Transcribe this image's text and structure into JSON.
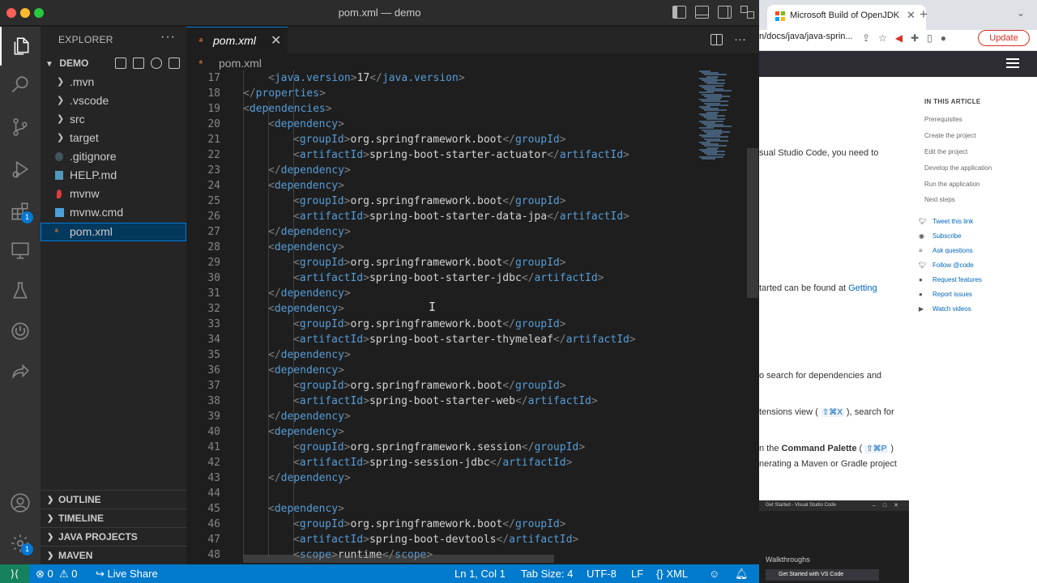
{
  "window": {
    "title": "pom.xml — demo"
  },
  "activity_badges": {
    "extensions": "1",
    "accounts": "1"
  },
  "sidebar": {
    "title": "EXPLORER",
    "more": "···",
    "project": "DEMO",
    "items": [
      {
        "label": ".mvn",
        "type": "folder"
      },
      {
        "label": ".vscode",
        "type": "folder"
      },
      {
        "label": "src",
        "type": "folder"
      },
      {
        "label": "target",
        "type": "folder"
      },
      {
        "label": ".gitignore",
        "type": "file"
      },
      {
        "label": "HELP.md",
        "type": "file"
      },
      {
        "label": "mvnw",
        "type": "file"
      },
      {
        "label": "mvnw.cmd",
        "type": "file"
      },
      {
        "label": "pom.xml",
        "type": "file",
        "selected": true
      }
    ],
    "sections": [
      "OUTLINE",
      "TIMELINE",
      "JAVA PROJECTS",
      "MAVEN"
    ]
  },
  "editor": {
    "tab_label": "pom.xml",
    "tab_close": "✕",
    "breadcrumb": "pom.xml",
    "lines": [
      {
        "n": "17",
        "indent": 2,
        "parts": [
          [
            "br",
            "<"
          ],
          [
            "tg",
            "java.version"
          ],
          [
            "br",
            ">"
          ],
          [
            "tx",
            "17"
          ],
          [
            "br",
            "</"
          ],
          [
            "tg",
            "java.version"
          ],
          [
            "br",
            ">"
          ]
        ]
      },
      {
        "n": "18",
        "indent": 1,
        "parts": [
          [
            "br",
            "</"
          ],
          [
            "tg",
            "properties"
          ],
          [
            "br",
            ">"
          ]
        ]
      },
      {
        "n": "19",
        "indent": 1,
        "parts": [
          [
            "br",
            "<"
          ],
          [
            "tg",
            "dependencies"
          ],
          [
            "br",
            ">"
          ]
        ]
      },
      {
        "n": "20",
        "indent": 2,
        "parts": [
          [
            "br",
            "<"
          ],
          [
            "tg",
            "dependency"
          ],
          [
            "br",
            ">"
          ]
        ]
      },
      {
        "n": "21",
        "indent": 3,
        "parts": [
          [
            "br",
            "<"
          ],
          [
            "tg",
            "groupId"
          ],
          [
            "br",
            ">"
          ],
          [
            "tx",
            "org.springframework.boot"
          ],
          [
            "br",
            "</"
          ],
          [
            "tg",
            "groupId"
          ],
          [
            "br",
            ">"
          ]
        ]
      },
      {
        "n": "22",
        "indent": 3,
        "parts": [
          [
            "br",
            "<"
          ],
          [
            "tg",
            "artifactId"
          ],
          [
            "br",
            ">"
          ],
          [
            "tx",
            "spring-boot-starter-actuator"
          ],
          [
            "br",
            "</"
          ],
          [
            "tg",
            "artifactId"
          ],
          [
            "br",
            ">"
          ]
        ]
      },
      {
        "n": "23",
        "indent": 2,
        "parts": [
          [
            "br",
            "</"
          ],
          [
            "tg",
            "dependency"
          ],
          [
            "br",
            ">"
          ]
        ]
      },
      {
        "n": "24",
        "indent": 2,
        "parts": [
          [
            "br",
            "<"
          ],
          [
            "tg",
            "dependency"
          ],
          [
            "br",
            ">"
          ]
        ]
      },
      {
        "n": "25",
        "indent": 3,
        "parts": [
          [
            "br",
            "<"
          ],
          [
            "tg",
            "groupId"
          ],
          [
            "br",
            ">"
          ],
          [
            "tx",
            "org.springframework.boot"
          ],
          [
            "br",
            "</"
          ],
          [
            "tg",
            "groupId"
          ],
          [
            "br",
            ">"
          ]
        ]
      },
      {
        "n": "26",
        "indent": 3,
        "parts": [
          [
            "br",
            "<"
          ],
          [
            "tg",
            "artifactId"
          ],
          [
            "br",
            ">"
          ],
          [
            "tx",
            "spring-boot-starter-data-jpa"
          ],
          [
            "br",
            "</"
          ],
          [
            "tg",
            "artifactId"
          ],
          [
            "br",
            ">"
          ]
        ]
      },
      {
        "n": "27",
        "indent": 2,
        "parts": [
          [
            "br",
            "</"
          ],
          [
            "tg",
            "dependency"
          ],
          [
            "br",
            ">"
          ]
        ]
      },
      {
        "n": "28",
        "indent": 2,
        "parts": [
          [
            "br",
            "<"
          ],
          [
            "tg",
            "dependency"
          ],
          [
            "br",
            ">"
          ]
        ]
      },
      {
        "n": "29",
        "indent": 3,
        "parts": [
          [
            "br",
            "<"
          ],
          [
            "tg",
            "groupId"
          ],
          [
            "br",
            ">"
          ],
          [
            "tx",
            "org.springframework.boot"
          ],
          [
            "br",
            "</"
          ],
          [
            "tg",
            "groupId"
          ],
          [
            "br",
            ">"
          ]
        ]
      },
      {
        "n": "30",
        "indent": 3,
        "parts": [
          [
            "br",
            "<"
          ],
          [
            "tg",
            "artifactId"
          ],
          [
            "br",
            ">"
          ],
          [
            "tx",
            "spring-boot-starter-jdbc"
          ],
          [
            "br",
            "</"
          ],
          [
            "tg",
            "artifactId"
          ],
          [
            "br",
            ">"
          ]
        ]
      },
      {
        "n": "31",
        "indent": 2,
        "parts": [
          [
            "br",
            "</"
          ],
          [
            "tg",
            "dependency"
          ],
          [
            "br",
            ">"
          ]
        ]
      },
      {
        "n": "32",
        "indent": 2,
        "parts": [
          [
            "br",
            "<"
          ],
          [
            "tg",
            "dependency"
          ],
          [
            "br",
            ">"
          ]
        ]
      },
      {
        "n": "33",
        "indent": 3,
        "parts": [
          [
            "br",
            "<"
          ],
          [
            "tg",
            "groupId"
          ],
          [
            "br",
            ">"
          ],
          [
            "tx",
            "org.springframework.boot"
          ],
          [
            "br",
            "</"
          ],
          [
            "tg",
            "groupId"
          ],
          [
            "br",
            ">"
          ]
        ]
      },
      {
        "n": "34",
        "indent": 3,
        "parts": [
          [
            "br",
            "<"
          ],
          [
            "tg",
            "artifactId"
          ],
          [
            "br",
            ">"
          ],
          [
            "tx",
            "spring-boot-starter-thymeleaf"
          ],
          [
            "br",
            "</"
          ],
          [
            "tg",
            "artifactId"
          ],
          [
            "br",
            ">"
          ]
        ]
      },
      {
        "n": "35",
        "indent": 2,
        "parts": [
          [
            "br",
            "</"
          ],
          [
            "tg",
            "dependency"
          ],
          [
            "br",
            ">"
          ]
        ]
      },
      {
        "n": "36",
        "indent": 2,
        "parts": [
          [
            "br",
            "<"
          ],
          [
            "tg",
            "dependency"
          ],
          [
            "br",
            ">"
          ]
        ]
      },
      {
        "n": "37",
        "indent": 3,
        "parts": [
          [
            "br",
            "<"
          ],
          [
            "tg",
            "groupId"
          ],
          [
            "br",
            ">"
          ],
          [
            "tx",
            "org.springframework.boot"
          ],
          [
            "br",
            "</"
          ],
          [
            "tg",
            "groupId"
          ],
          [
            "br",
            ">"
          ]
        ]
      },
      {
        "n": "38",
        "indent": 3,
        "parts": [
          [
            "br",
            "<"
          ],
          [
            "tg",
            "artifactId"
          ],
          [
            "br",
            ">"
          ],
          [
            "tx",
            "spring-boot-starter-web"
          ],
          [
            "br",
            "</"
          ],
          [
            "tg",
            "artifactId"
          ],
          [
            "br",
            ">"
          ]
        ]
      },
      {
        "n": "39",
        "indent": 2,
        "parts": [
          [
            "br",
            "</"
          ],
          [
            "tg",
            "dependency"
          ],
          [
            "br",
            ">"
          ]
        ]
      },
      {
        "n": "40",
        "indent": 2,
        "parts": [
          [
            "br",
            "<"
          ],
          [
            "tg",
            "dependency"
          ],
          [
            "br",
            ">"
          ]
        ]
      },
      {
        "n": "41",
        "indent": 3,
        "parts": [
          [
            "br",
            "<"
          ],
          [
            "tg",
            "groupId"
          ],
          [
            "br",
            ">"
          ],
          [
            "tx",
            "org.springframework.session"
          ],
          [
            "br",
            "</"
          ],
          [
            "tg",
            "groupId"
          ],
          [
            "br",
            ">"
          ]
        ]
      },
      {
        "n": "42",
        "indent": 3,
        "parts": [
          [
            "br",
            "<"
          ],
          [
            "tg",
            "artifactId"
          ],
          [
            "br",
            ">"
          ],
          [
            "tx",
            "spring-session-jdbc"
          ],
          [
            "br",
            "</"
          ],
          [
            "tg",
            "artifactId"
          ],
          [
            "br",
            ">"
          ]
        ]
      },
      {
        "n": "43",
        "indent": 2,
        "parts": [
          [
            "br",
            "</"
          ],
          [
            "tg",
            "dependency"
          ],
          [
            "br",
            ">"
          ]
        ]
      },
      {
        "n": "44",
        "indent": 0,
        "parts": []
      },
      {
        "n": "45",
        "indent": 2,
        "parts": [
          [
            "br",
            "<"
          ],
          [
            "tg",
            "dependency"
          ],
          [
            "br",
            ">"
          ]
        ]
      },
      {
        "n": "46",
        "indent": 3,
        "parts": [
          [
            "br",
            "<"
          ],
          [
            "tg",
            "groupId"
          ],
          [
            "br",
            ">"
          ],
          [
            "tx",
            "org.springframework.boot"
          ],
          [
            "br",
            "</"
          ],
          [
            "tg",
            "groupId"
          ],
          [
            "br",
            ">"
          ]
        ]
      },
      {
        "n": "47",
        "indent": 3,
        "parts": [
          [
            "br",
            "<"
          ],
          [
            "tg",
            "artifactId"
          ],
          [
            "br",
            ">"
          ],
          [
            "tx",
            "spring-boot-devtools"
          ],
          [
            "br",
            "</"
          ],
          [
            "tg",
            "artifactId"
          ],
          [
            "br",
            ">"
          ]
        ]
      },
      {
        "n": "48",
        "indent": 3,
        "parts": [
          [
            "br",
            "<"
          ],
          [
            "tg",
            "scope"
          ],
          [
            "br",
            ">"
          ],
          [
            "tx",
            "runtime"
          ],
          [
            "br",
            "</"
          ],
          [
            "tg",
            "scope"
          ],
          [
            "br",
            ">"
          ]
        ]
      }
    ]
  },
  "statusbar": {
    "remote": "⟩⟨",
    "errors": "0",
    "warnings": "0",
    "live_share": "Live Share",
    "position": "Ln 1, Col 1",
    "tab_size": "Tab Size: 4",
    "encoding": "UTF-8",
    "eol": "LF",
    "language": "XML"
  },
  "browser": {
    "tab_title": "Microsoft Build of OpenJDK",
    "tab_close": "✕",
    "new_tab": "+",
    "url": "n/docs/java/java-sprin...",
    "update_label": "Update",
    "article_fragments": [
      {
        "text": "sual Studio Code, you need to",
        "link": ""
      },
      {
        "text": "tarted can be found at ",
        "link": "Getting"
      },
      {
        "text": "o search for dependencies and",
        "link": ""
      },
      {
        "text": "tensions view ( ",
        "kbd": "⇧⌘X",
        "after": " ), search for"
      },
      {
        "text": "n the ",
        "bold": "Command Palette",
        "kbd": "⇧⌘P",
        "after": " )"
      },
      {
        "text": "nerating a Maven or Gradle project",
        "link": ""
      }
    ],
    "toc_heading": "IN THIS ARTICLE",
    "toc_items": [
      "Prerequisites",
      "Create the project",
      "Edit the project",
      "Develop the application",
      "Run the application",
      "Next steps"
    ],
    "external_links": [
      "Tweet this link",
      "Subscribe",
      "Ask questions",
      "Follow @code",
      "Request features",
      "Report issues",
      "Watch videos"
    ],
    "mini_window": {
      "title": "Get Started - Visual Studio Code",
      "walkthroughs": "Walkthroughs",
      "get_started": "Get Started with VS Code"
    }
  }
}
